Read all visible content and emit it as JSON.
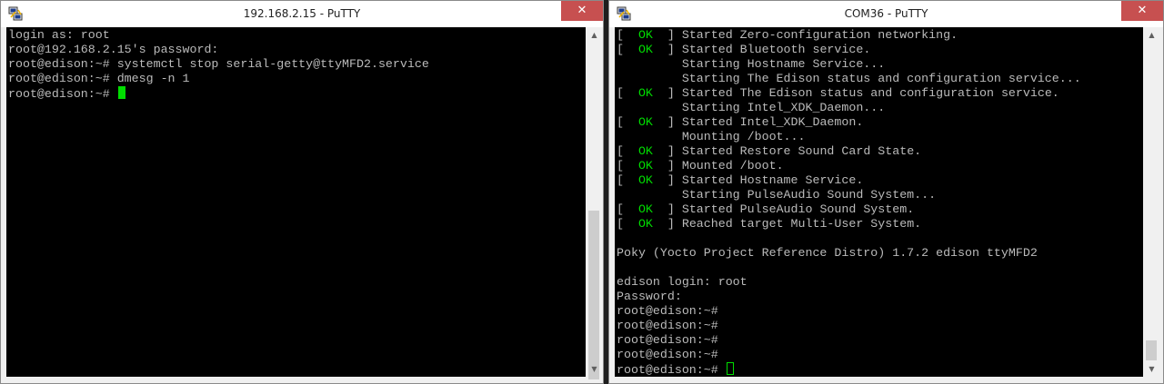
{
  "colors": {
    "terminal_bg": "#000000",
    "terminal_text": "#bbbbbb",
    "ok_green": "#00dd00",
    "close_button": "#c75050"
  },
  "left": {
    "title": "192.168.2.15 - PuTTY",
    "close_glyph": "✕",
    "lines": [
      "login as: root",
      "root@192.168.2.15's password:",
      "root@edison:~# systemctl stop serial-getty@ttyMFD2.service",
      "root@edison:~# dmesg -n 1",
      "root@edison:~# "
    ]
  },
  "right": {
    "title": "COM36 - PuTTY",
    "close_glyph": "✕",
    "ok_text": "OK",
    "lines": [
      {
        "ok": true,
        "text": "Started Zero-configuration networking."
      },
      {
        "ok": true,
        "text": "Started Bluetooth service."
      },
      {
        "ok": false,
        "text": "         Starting Hostname Service..."
      },
      {
        "ok": false,
        "text": "         Starting The Edison status and configuration service..."
      },
      {
        "ok": true,
        "text": "Started The Edison status and configuration service."
      },
      {
        "ok": false,
        "text": "         Starting Intel_XDK_Daemon..."
      },
      {
        "ok": true,
        "text": "Started Intel_XDK_Daemon."
      },
      {
        "ok": false,
        "text": "         Mounting /boot..."
      },
      {
        "ok": true,
        "text": "Started Restore Sound Card State."
      },
      {
        "ok": true,
        "text": "Mounted /boot."
      },
      {
        "ok": true,
        "text": "Started Hostname Service."
      },
      {
        "ok": false,
        "text": "         Starting PulseAudio Sound System..."
      },
      {
        "ok": true,
        "text": "Started PulseAudio Sound System."
      },
      {
        "ok": true,
        "text": "Reached target Multi-User System."
      },
      {
        "ok": false,
        "text": ""
      },
      {
        "ok": false,
        "text": "Poky (Yocto Project Reference Distro) 1.7.2 edison ttyMFD2"
      },
      {
        "ok": false,
        "text": ""
      },
      {
        "ok": false,
        "text": "edison login: root"
      },
      {
        "ok": false,
        "text": "Password:"
      },
      {
        "ok": false,
        "text": "root@edison:~#"
      },
      {
        "ok": false,
        "text": "root@edison:~#"
      },
      {
        "ok": false,
        "text": "root@edison:~#"
      },
      {
        "ok": false,
        "text": "root@edison:~#"
      },
      {
        "ok": false,
        "text": "root@edison:~# "
      }
    ]
  }
}
